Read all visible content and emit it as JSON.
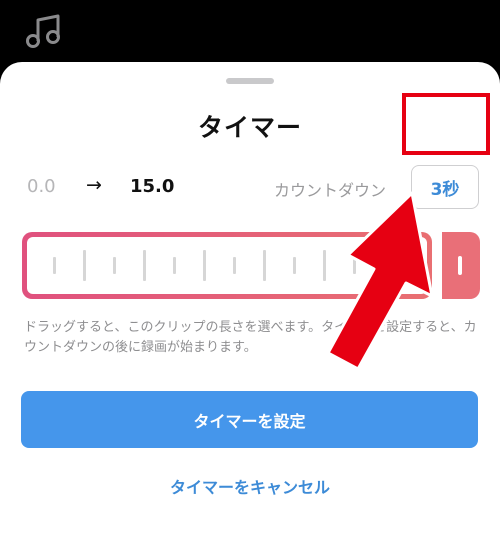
{
  "icons": {
    "music": "music-note-icon"
  },
  "sheet": {
    "title": "タイマー",
    "range": {
      "start": "0.0",
      "arrow": "→",
      "end": "15.0"
    },
    "countdown": {
      "label": "カウントダウン",
      "value": "3秒"
    },
    "description": "ドラッグすると、このクリップの長さを選べます。タイマーを設定すると、カウントダウンの後に録画が始まります。",
    "set_timer_button": "タイマーを設定",
    "cancel_timer_link": "タイマーをキャンセル"
  },
  "colors": {
    "accent_blue": "#4596eb",
    "link_blue": "#3d8bd7",
    "clip_gradient_start": "#e0517e",
    "clip_gradient_end": "#e96f72",
    "annotation_red": "#e60012"
  }
}
